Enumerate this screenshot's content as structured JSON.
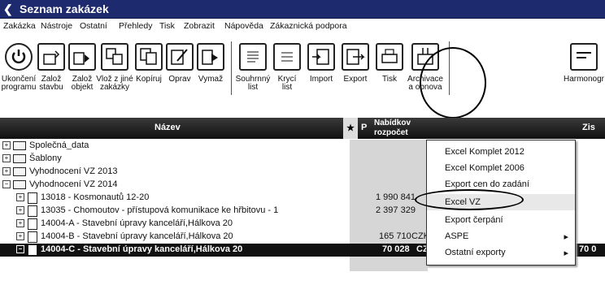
{
  "window": {
    "title": "Seznam zakázek",
    "back_icon": "chevron-left-icon"
  },
  "menubar": [
    "Zakázka",
    "Nástroje",
    "Ostatní",
    "Přehledy",
    "Tisk",
    "Zobrazit",
    "Nápověda",
    "Zákaznická podpora"
  ],
  "toolbar": {
    "buttons": [
      {
        "label": "Ukončení\nprogramu",
        "icon": "power-icon"
      },
      {
        "label": "Založ\nstavbu",
        "icon": "new-building-icon"
      },
      {
        "label": "Založ\nobjekt",
        "icon": "new-object-icon"
      },
      {
        "label": "Vlož z jiné\nzakázky",
        "icon": "insert-icon"
      },
      {
        "label": "Kopíruj",
        "icon": "copy-icon"
      },
      {
        "label": "Oprav",
        "icon": "edit-icon"
      },
      {
        "label": "Vymaž",
        "icon": "delete-icon"
      },
      {
        "label": "Souhrnný\nlist",
        "icon": "summary-icon"
      },
      {
        "label": "Krycí\nlist",
        "icon": "cover-sheet-icon"
      },
      {
        "label": "Import",
        "icon": "import-icon"
      },
      {
        "label": "Export",
        "icon": "export-icon"
      },
      {
        "label": "Tisk",
        "icon": "print-icon"
      },
      {
        "label": "Archivace\na obnova",
        "icon": "archive-icon"
      },
      {
        "label": "Harmonogr",
        "icon": "schedule-icon"
      }
    ]
  },
  "table": {
    "headers": {
      "name": "Název",
      "star": "★",
      "p": "P",
      "budget": "Nabídkov\nrozpočet",
      "profit": "Zis"
    },
    "rows": [
      {
        "label": "Společná_data",
        "exp": "+"
      },
      {
        "label": "Šablony",
        "exp": "+"
      },
      {
        "label": "Vyhodnocení VZ 2013",
        "exp": "+"
      },
      {
        "label": "Vyhodnocení VZ 2014",
        "exp": "−"
      },
      {
        "label": "13018 - Kosmonautů 12-20",
        "exp": "+",
        "value": "1 990 841"
      },
      {
        "label": "13035 - Chomoutov - přístupová komunikace ke hřbitovu - 1",
        "exp": "+",
        "value": "2 397 329"
      },
      {
        "label": "14004-A - Stavební úpravy kanceláří,Hálkova 20",
        "exp": "+",
        "value": ""
      },
      {
        "label": "14004-B - Stavební úpravy kanceláří,Hálkova 20",
        "exp": "+",
        "value": "165 710",
        "cur": "CZK"
      },
      {
        "label": "14004-C - Stavební úpravy kanceláří,Hálkova 20",
        "exp": "−",
        "value": "70 028",
        "cur": "CZK",
        "value2": "70 0"
      }
    ]
  },
  "export_menu": [
    {
      "label": "Excel Komplet 2012"
    },
    {
      "label": "Excel Komplet 2006"
    },
    {
      "label": "Export cen do zadání"
    },
    {
      "label": "Excel VZ"
    },
    {
      "label": "Export čerpání"
    },
    {
      "label": "ASPE",
      "arrow": "▸"
    },
    {
      "label": "Ostatní exporty",
      "arrow": "▸"
    }
  ]
}
